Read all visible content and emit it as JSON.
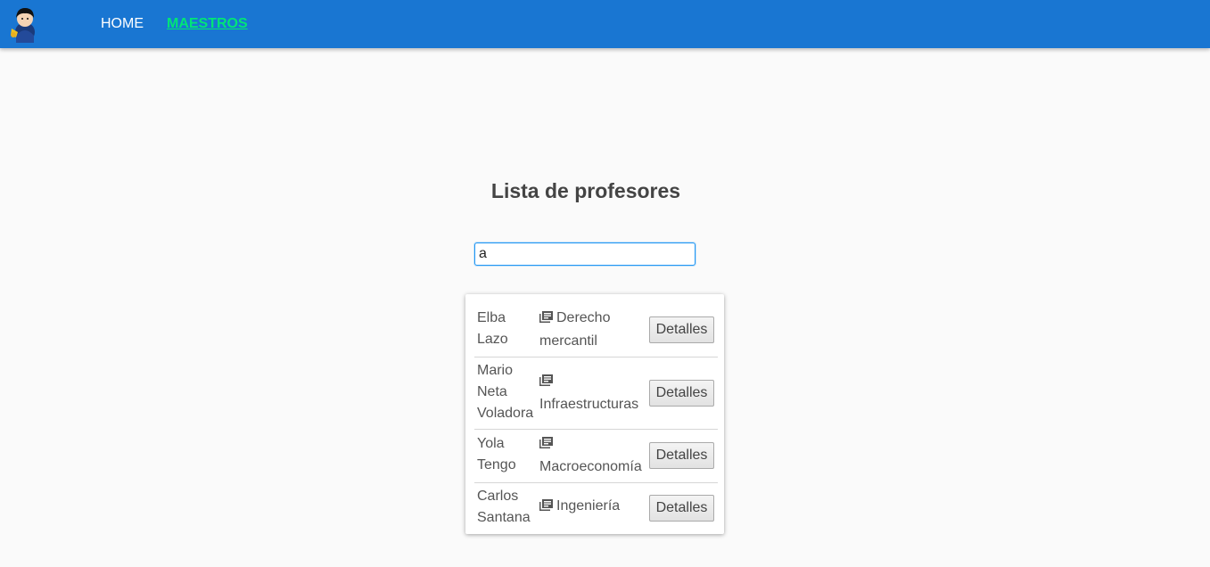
{
  "nav": {
    "home": "HOME",
    "maestros": "MAESTROS"
  },
  "page": {
    "title": "Lista de profesores"
  },
  "search": {
    "value": "a"
  },
  "teachers": [
    {
      "name_lines": [
        "Elba",
        "Lazo"
      ],
      "subject_lines": [
        "Derecho",
        "mercantil"
      ],
      "button": "Detalles"
    },
    {
      "name_lines": [
        "Mario",
        "Neta",
        "Voladora"
      ],
      "subject_lines": [
        "",
        "Infraestructuras"
      ],
      "button": "Detalles"
    },
    {
      "name_lines": [
        "Yola",
        "Tengo"
      ],
      "subject_lines": [
        "",
        "Macroeconomía"
      ],
      "button": "Detalles"
    },
    {
      "name_lines": [
        "Carlos",
        "Santana"
      ],
      "subject_lines": [
        "Ingeniería"
      ],
      "button": "Detalles"
    }
  ],
  "colors": {
    "navbar": "#1976d2",
    "active_link": "#00e676",
    "background": "#fafafa"
  },
  "icons": {
    "logo": "user-avatar-icon",
    "subject": "book-icon"
  }
}
